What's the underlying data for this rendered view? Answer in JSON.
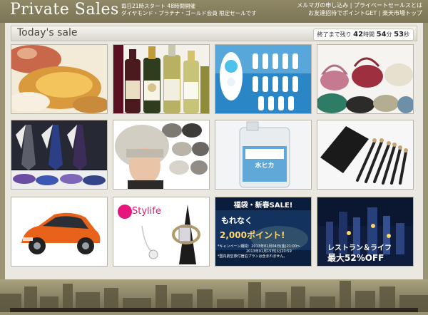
{
  "header": {
    "logo": "Private Sales",
    "subline1": "毎日21時スタート 48時間開催",
    "subline2": "ダイヤモンド・プラチナ・ゴールド会員 限定セールです",
    "link_mail": "メルマガの申し込み",
    "link_about": "プライベートセールスとは",
    "link_points": "お友達招待でポイントGET",
    "link_top": "楽天市場トップ"
  },
  "section": {
    "title": "Today's sale",
    "countdown_label": "終了まで残り",
    "hours": "42",
    "hours_unit": "時間",
    "minutes": "54",
    "minutes_unit": "分",
    "seconds": "53",
    "seconds_unit": "秒"
  },
  "tiles": [
    {
      "subject": "crab-bread",
      "texts": []
    },
    {
      "subject": "wine-bottles",
      "texts": []
    },
    {
      "subject": "toothbrush-heads",
      "texts": []
    },
    {
      "subject": "leather-bags",
      "texts": []
    },
    {
      "subject": "neckties",
      "texts": []
    },
    {
      "subject": "knit-hats",
      "texts": []
    },
    {
      "subject": "water-container",
      "texts": [
        "水ヒカ"
      ]
    },
    {
      "subject": "makeup-brushes",
      "texts": []
    },
    {
      "subject": "orange-car",
      "texts": []
    },
    {
      "subject": "jewelry",
      "texts": [
        "Stylife"
      ]
    },
    {
      "subject": "newyear-sale",
      "texts": [
        "福袋・新春SALE!",
        "もれなく",
        "2,000ポイント!",
        "*キャンペーン期間：2013年01月04日(金)21:00～",
        "2013年01月15日(火)20:59",
        "*国内航空券付宿泊プランは含まれません。"
      ]
    },
    {
      "subject": "city-night",
      "texts": [
        "レストラン＆ライフ",
        "最大52%OFF"
      ]
    }
  ],
  "colors": {
    "header_bg": "#8a8362",
    "content_bg": "#eae8e1",
    "car": "#e8621a",
    "sale_red": "#d8181e",
    "sale_gold": "#ffd66a"
  }
}
